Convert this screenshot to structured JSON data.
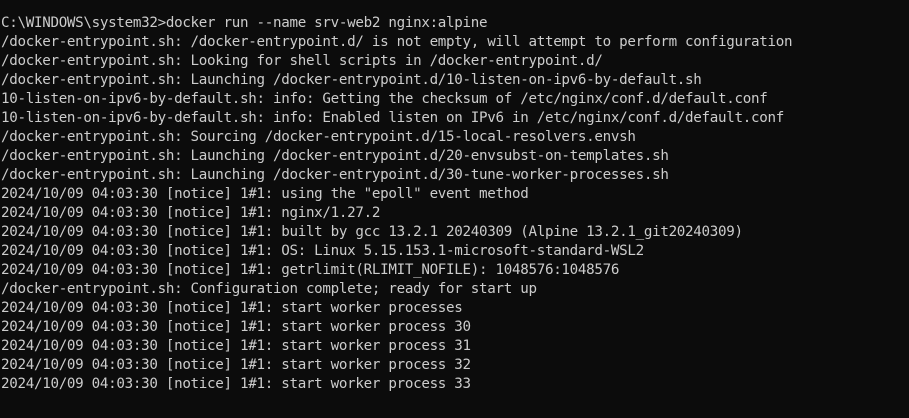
{
  "terminal": {
    "lines": [
      "C:\\WINDOWS\\system32>docker run --name srv-web2 nginx:alpine",
      "/docker-entrypoint.sh: /docker-entrypoint.d/ is not empty, will attempt to perform configuration",
      "/docker-entrypoint.sh: Looking for shell scripts in /docker-entrypoint.d/",
      "/docker-entrypoint.sh: Launching /docker-entrypoint.d/10-listen-on-ipv6-by-default.sh",
      "10-listen-on-ipv6-by-default.sh: info: Getting the checksum of /etc/nginx/conf.d/default.conf",
      "10-listen-on-ipv6-by-default.sh: info: Enabled listen on IPv6 in /etc/nginx/conf.d/default.conf",
      "/docker-entrypoint.sh: Sourcing /docker-entrypoint.d/15-local-resolvers.envsh",
      "/docker-entrypoint.sh: Launching /docker-entrypoint.d/20-envsubst-on-templates.sh",
      "/docker-entrypoint.sh: Launching /docker-entrypoint.d/30-tune-worker-processes.sh",
      "2024/10/09 04:03:30 [notice] 1#1: using the \"epoll\" event method",
      "2024/10/09 04:03:30 [notice] 1#1: nginx/1.27.2",
      "2024/10/09 04:03:30 [notice] 1#1: built by gcc 13.2.1 20240309 (Alpine 13.2.1_git20240309)",
      "2024/10/09 04:03:30 [notice] 1#1: OS: Linux 5.15.153.1-microsoft-standard-WSL2",
      "2024/10/09 04:03:30 [notice] 1#1: getrlimit(RLIMIT_NOFILE): 1048576:1048576",
      "/docker-entrypoint.sh: Configuration complete; ready for start up",
      "2024/10/09 04:03:30 [notice] 1#1: start worker processes",
      "2024/10/09 04:03:30 [notice] 1#1: start worker process 30",
      "2024/10/09 04:03:30 [notice] 1#1: start worker process 31",
      "2024/10/09 04:03:30 [notice] 1#1: start worker process 32",
      "2024/10/09 04:03:30 [notice] 1#1: start worker process 33"
    ]
  },
  "colors": {
    "background": "#0c0c0c",
    "foreground": "#cccccc"
  }
}
